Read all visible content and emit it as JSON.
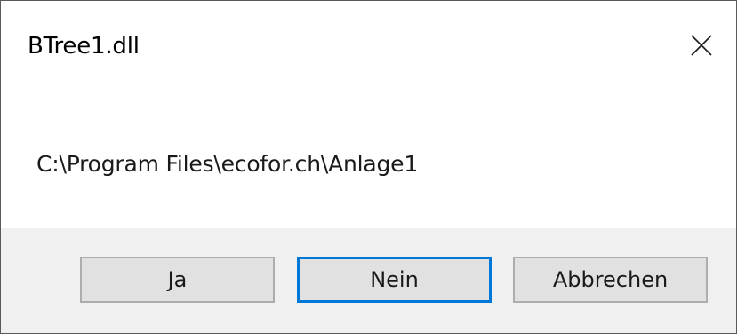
{
  "dialog": {
    "title": "BTree1.dll",
    "close_icon": "close-icon",
    "message": "C:\\Program Files\\ecofor.ch\\Anlage1"
  },
  "buttons": {
    "yes_label": "Ja",
    "no_label": "Nein",
    "cancel_label": "Abbrechen",
    "default_button": "Nein"
  },
  "colors": {
    "accent_focus_border": "#0078d7",
    "button_face": "#e1e1e1",
    "button_border": "#adadad",
    "footer_background": "#f0f0f0",
    "window_border": "#5a5a5a"
  }
}
